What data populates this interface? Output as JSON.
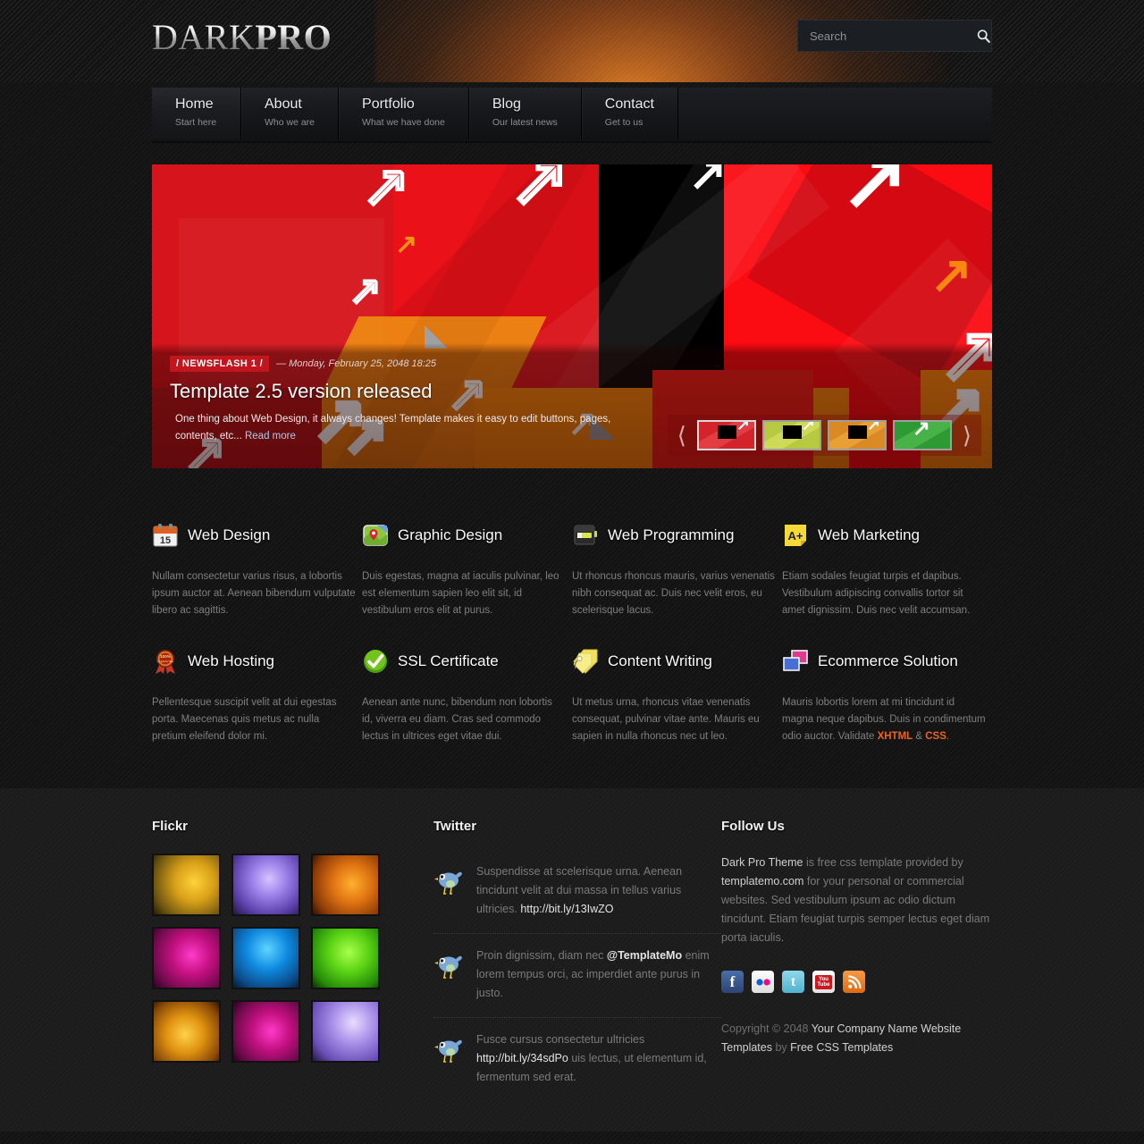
{
  "site": {
    "logo_dark": "DARK",
    "logo_pro": "PRO"
  },
  "search": {
    "placeholder": "Search",
    "value": "",
    "icon": "search-icon"
  },
  "nav": {
    "items": [
      {
        "label": "Home",
        "sub": "Start here",
        "active": true
      },
      {
        "label": "About",
        "sub": "Who we are",
        "active": false
      },
      {
        "label": "Portfolio",
        "sub": "What we have done",
        "active": false
      },
      {
        "label": "Blog",
        "sub": "Our latest news",
        "active": false
      },
      {
        "label": "Contact",
        "sub": "Get to us",
        "active": false
      }
    ]
  },
  "slider": {
    "badge": "/ NEWSFLASH 1 /",
    "date": "— Monday, February 25, 2048 18:25",
    "title": "Template 2.5 version released",
    "text": "One thing about Web Design, it always changes! Template makes it easy to edit buttons, pages, contents, etc... ",
    "read_more": "Read more",
    "prev_icon": "chevron-left-icon",
    "next_icon": "chevron-right-icon",
    "thumbs": [
      {
        "name": "slide-thumb-1",
        "color": "#d3232b",
        "accent": "#f0535a",
        "selected": true
      },
      {
        "name": "slide-thumb-2",
        "color": "#b6c940",
        "accent": "#e2e86a",
        "selected": false
      },
      {
        "name": "slide-thumb-3",
        "color": "#d98a24",
        "accent": "#f2b045",
        "selected": false
      },
      {
        "name": "slide-thumb-4",
        "color": "#2e9a34",
        "accent": "#5fc45a",
        "selected": false
      }
    ]
  },
  "services": [
    {
      "id": "web-design",
      "icon": "calendar-icon",
      "icon_value": "15",
      "title": "Web Design",
      "text": "Nullam consectetur varius risus, a lobortis ipsum auctor at. Aenean bibendum vulputate libero ac sagittis."
    },
    {
      "id": "graphic-design",
      "icon": "map-pin-icon",
      "title": "Graphic Design",
      "text": "Duis egestas, magna at iaculis pulvinar, leo est elementum sapien leo elit sit, id vestibulum eros elit at purus."
    },
    {
      "id": "web-programming",
      "icon": "battery-icon",
      "title": "Web Programming",
      "text": "Ut rhoncus rhoncus mauris, varius venenatis nibh consequat ac. Duis nec velit eros, eu scelerisque lacus."
    },
    {
      "id": "web-marketing",
      "icon": "grade-note-icon",
      "icon_value": "A+",
      "title": "Web Marketing",
      "text": "Etiam sodales feugiat turpis et dapibus. Vestibulum adipiscing convallis tortor sit amet dignissim. Duis nec velit accumsan."
    },
    {
      "id": "web-hosting",
      "icon": "guarantee-ribbon-icon",
      "icon_value": "100%",
      "title": "Web Hosting",
      "text": "Pellentesque suscipit velit at dui egestas porta. Maecenas quis metus ac nulla pretium eleifend dolor mi."
    },
    {
      "id": "ssl-certificate",
      "icon": "check-circle-icon",
      "title": "SSL Certificate",
      "text": "Aenean ante nunc, bibendum non lobortis id, viverra eu diam. Cras sed commodo lectus in ultrices eget vitae dui."
    },
    {
      "id": "content-writing",
      "icon": "tags-icon",
      "title": "Content Writing",
      "text": "Ut metus urna, rhoncus vitae venenatis consequat, pulvinar vitae ante. Mauris eu sapien in nulla rhoncus nec ut leo."
    },
    {
      "id": "ecommerce-solution",
      "icon": "windows-icon",
      "title": "Ecommerce Solution",
      "text_before": "Mauris lobortis lorem at mi tincidunt id magna neque dapibus. Duis in condimentum odio auctor. Validate ",
      "link1": "XHTML",
      "text_mid": " & ",
      "link2": "CSS",
      "text_after": "."
    }
  ],
  "footer": {
    "flickr": {
      "heading": "Flickr",
      "thumbs": [
        {
          "name": "flickr-thumb-1",
          "c1": "#6b5410",
          "c2": "#ffd23a",
          "c3": "#c98f12"
        },
        {
          "name": "flickr-thumb-2",
          "c1": "#3a2a6b",
          "c2": "#c9a8ff",
          "c3": "#7b5ed6"
        },
        {
          "name": "flickr-thumb-3",
          "c1": "#7a3609",
          "c2": "#ffb02e",
          "c3": "#d9600f"
        },
        {
          "name": "flickr-thumb-4",
          "c1": "#6b0a4a",
          "c2": "#ff2ec4",
          "c3": "#c2107f"
        },
        {
          "name": "flickr-thumb-5",
          "c1": "#0b3f86",
          "c2": "#3ec4ff",
          "c3": "#0f79d6"
        },
        {
          "name": "flickr-thumb-6",
          "c1": "#1f6b09",
          "c2": "#8bff2e",
          "c3": "#46c210"
        },
        {
          "name": "flickr-thumb-7",
          "c1": "#7a4309",
          "c2": "#ffc83a",
          "c3": "#e08a10"
        },
        {
          "name": "flickr-thumb-8",
          "c1": "#6b0a4a",
          "c2": "#ff2ec4",
          "c3": "#c2107f"
        },
        {
          "name": "flickr-thumb-9",
          "c1": "#3a2a6b",
          "c2": "#d8c2ff",
          "c3": "#8b6fe0"
        }
      ]
    },
    "twitter": {
      "heading": "Twitter",
      "bird_icon": "twitter-bird-icon",
      "tweets": [
        {
          "before": "Suspendisse at scelerisque urna. Aenean tincidunt velit at dui massa in tellus varius ultricies. ",
          "link": "http://bit.ly/13IwZO",
          "after": ""
        },
        {
          "before": "Proin dignissim, diam nec ",
          "link": "@TemplateMo",
          "after": " enim lorem tempus orci, ac imperdiet ante purus in justo."
        },
        {
          "before": "Fusce cursus consectetur ultricies ",
          "link": "http://bit.ly/34sdPo",
          "after": " uis lectus, ut elementum id, fermentum sed erat."
        }
      ]
    },
    "follow": {
      "heading": "Follow Us",
      "strong1": "Dark Pro Theme",
      "mid1": " is free css template provided by ",
      "strong2": "templatemo.com",
      "rest": " for your personal or commercial websites. Sed vestibulum ipsum ac odio dictum tincidunt. Etiam feugiat turpis semper lectus eget diam porta iaculis.",
      "social": [
        {
          "name": "facebook-icon",
          "label": "f",
          "bg": "#3b5998"
        },
        {
          "name": "flickr-icon",
          "label": "",
          "bg": "#eeeeee"
        },
        {
          "name": "twitter-icon",
          "label": "t",
          "bg": "#6fc9e0"
        },
        {
          "name": "youtube-icon",
          "label": "You",
          "bg": "#f0f0f0"
        },
        {
          "name": "rss-icon",
          "label": "",
          "bg": "#ef7c28"
        }
      ]
    },
    "copyright": {
      "pre": "Copyright © 2048 ",
      "company": "Your Company Name",
      "mid": " ",
      "templates": "Website Templates",
      "by": " by ",
      "free": "Free CSS Templates"
    }
  },
  "colors": {
    "accent_orange": "#e8651a",
    "slider_red": "#e60f17",
    "badge_red": "#c2161f",
    "footer_bg": "#1c1c1c",
    "page_bg": "#131313"
  }
}
